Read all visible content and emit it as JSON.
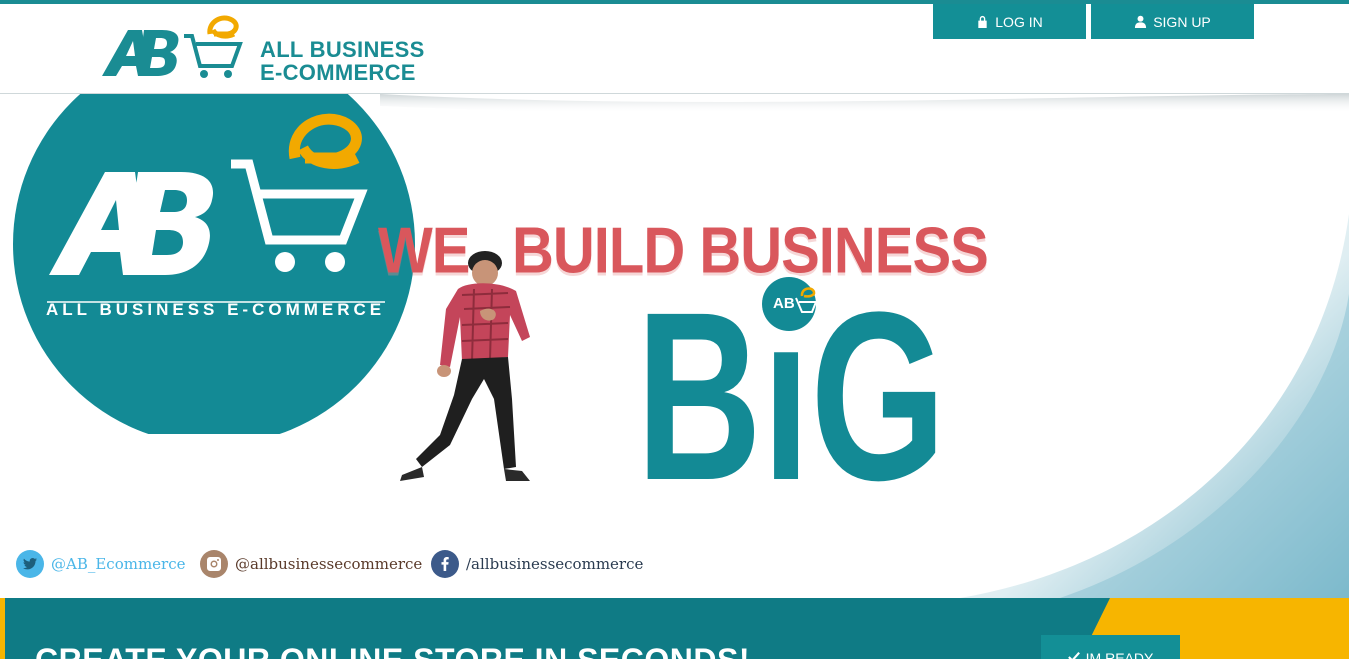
{
  "header": {
    "brand_line1": "ALL BUSINESS",
    "brand_line2": "E-COMMERCE",
    "login_label": "LOG IN",
    "signup_label": "SIGN UP"
  },
  "hero": {
    "circle_logo_tagline": "ALL BUSINESS E-COMMERCE",
    "headline_word1": "WE",
    "headline_word2": "BUILD BUSINESS",
    "big_word": "BiG",
    "social": [
      {
        "handle": "@AB_Ecommerce",
        "icon": "twitter-icon"
      },
      {
        "handle": "@allbusinessecommerce",
        "icon": "instagram-icon"
      },
      {
        "handle": "/allbusinessecommerce",
        "icon": "facebook-icon"
      }
    ]
  },
  "cta": {
    "title": "CREATE YOUR ONLINE STORE IN SECONDS!",
    "button_label": "IM READY"
  },
  "colors": {
    "teal": "#1a8c93",
    "accent_yellow": "#f7b500",
    "headline_red": "#d9575c"
  }
}
